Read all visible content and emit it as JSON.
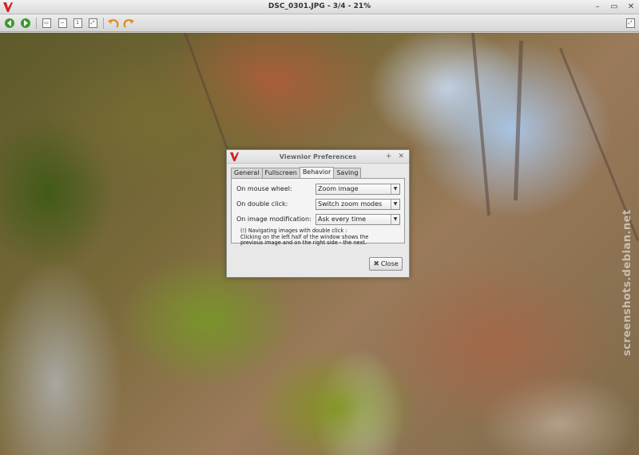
{
  "window": {
    "title": "DSC_0301.JPG - 3/4 - 21%",
    "wm_buttons": [
      "–",
      "▭",
      "✕"
    ]
  },
  "toolbar": {
    "items": [
      {
        "name": "back-button",
        "glyph": "◀"
      },
      {
        "name": "forward-button",
        "glyph": "▶"
      },
      {
        "name": "fit-page-button",
        "glyph": "▭"
      },
      {
        "name": "zoom-out-button",
        "glyph": "−"
      },
      {
        "name": "zoom-normal-button",
        "glyph": "1"
      },
      {
        "name": "zoom-fit-button",
        "glyph": "⤢"
      },
      {
        "name": "rotate-left-button",
        "glyph": "↶"
      },
      {
        "name": "rotate-right-button",
        "glyph": "↷"
      }
    ],
    "fullscreen_glyph": "⤢"
  },
  "watermark": "screenshots.debian.net",
  "dialog": {
    "title": "Viewnior Preferences",
    "wm_buttons": [
      "+",
      "✕"
    ],
    "tabs": [
      "General",
      "Fullscreen",
      "Behavior",
      "Saving"
    ],
    "active_tab": "Behavior",
    "rows": [
      {
        "label": "On mouse wheel:",
        "value": "Zoom image"
      },
      {
        "label": "On double click:",
        "value": "Switch zoom modes"
      },
      {
        "label": "On image modification:",
        "value": "Ask every time"
      }
    ],
    "note_line1": "(!) Navigating images with double click :",
    "note_line2": "Clicking on the left half of the window shows the",
    "note_line3": "previous image and on the right side - the next.",
    "close_label": "Close"
  },
  "colors": {
    "logo_red": "#d42020",
    "arrow_green": "#3a9a2a",
    "rotate_orange": "#e08a1a"
  }
}
